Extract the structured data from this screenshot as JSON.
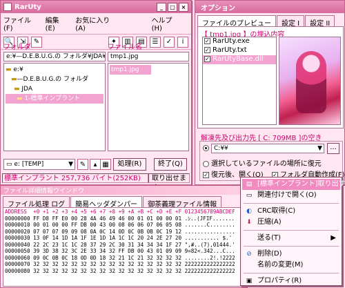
{
  "main": {
    "title": "RarUty",
    "menu": [
      "ファイル(F)",
      "編集(E)",
      "お気に入り(A)",
      "ヘルプ(H)"
    ],
    "folder_label": "フォルダ",
    "filename_label": "ファイル名",
    "folder_path": "e:¥—D.E.B.U.G.の フォルダ¥JDA¥",
    "filename_value": "tmp1.jpg",
    "tree": [
      "e:¥",
      "—D.E.B.U.G.の フォルダ",
      "JDA",
      "1-標準インプラント"
    ],
    "files": [
      "tmp1.jpg"
    ],
    "drive": "e: [TEMP]",
    "process_button": "処理(R)",
    "exit_button": "終了(Q)",
    "status_left": "標準インプラント  257,736 バイト(252KB)",
    "status_right": "取り出せます"
  },
  "options": {
    "title": "オプション",
    "tabs": [
      "ファイルのプレビュー",
      "設定 I",
      "設定 II"
    ],
    "embed_title": "【 tmp1.jpg 】の埋込内容",
    "embed_items": [
      {
        "label": "RarUty.exe",
        "checked": true
      },
      {
        "label": "RarUty.txt",
        "checked": true
      },
      {
        "label": "RarUtyBase.dll",
        "checked": true
      }
    ],
    "dest_title": "解凍先及び出力先 [ C: 709MB ]の空き",
    "dest_value": "C:¥¥",
    "radio_label": "選択しているファイルの場所に復元",
    "restore_label": "復元後、開く(O)",
    "auto_folder_label": "フォルダ自動作成(F)"
  },
  "detail": {
    "title": "ファイル詳細情報ウインドウ",
    "tabs": [
      "ファイル処理 ログ",
      "簡易ヘッダダンパー",
      "御茶義理ファイル情報"
    ],
    "hex_header": "ADDRESS  +0 +1 +2 +3 +4 +5 +6 +7 +8 +9 +A +B +C +D +E +F 0123456789ABCDEF",
    "hex_rows": [
      "00000000 FF D8 FF E0 00 28 4A 46 49 46 00 01 01 00 00 01 .ｼ..(JFIF.......",
      "00000010 00 01 00 00 FF DB 00 43 00 08 06 06 07 06 05 08 .......C........",
      "00000020 07 07 07 09 09 08 0A 0C 14 0D 0C 0B 0B 0C 19 12 ................",
      "00000030 13 0F 14 1D 1A 1F 1E 1D 1A 1C 1C 20 24 2E 27 20 ........... $.' ",
      "00000040 22 2C 23 1C 1C 28 37 29 2C 30 31 34 34 34 1F 27 \",#..(7),01444.'",
      "00000050 39 3D 38 32 3C 2E 33 34 32 FF DB 00 43 01 09 09 9=82<.342...C...",
      "00000060 09 0C 0B 0C 18 0D 0D 18 32 21 1C 21 32 32 32 32 ........2!.!2222",
      "00000070 32 32 32 32 32 32 32 32 32 32 32 32 32 32 32 32 2222222222222222",
      "00000080 32 32 32 32 32 32 32 32 32 32 32 32 32 32 32 32 2222222222222222"
    ]
  },
  "context_menu": {
    "items": [
      {
        "label": "[標準インプラント]取り出す(E)",
        "highlight": true
      },
      {
        "label": "関連付けで開く(O)"
      },
      {
        "sep": true
      },
      {
        "label": "CRC取得(C)"
      },
      {
        "label": "圧縮(A)"
      },
      {
        "sep": true
      },
      {
        "label": "送る(T)",
        "arrow": true
      },
      {
        "sep": true
      },
      {
        "label": "削除(D)"
      },
      {
        "label": "名前の変更(M)"
      },
      {
        "sep": true
      },
      {
        "label": "プロパティ(R)"
      }
    ]
  },
  "colors": {
    "accent": "#d86a9e",
    "selection": "#f3a3cf",
    "highlight_text": "#d00070"
  }
}
